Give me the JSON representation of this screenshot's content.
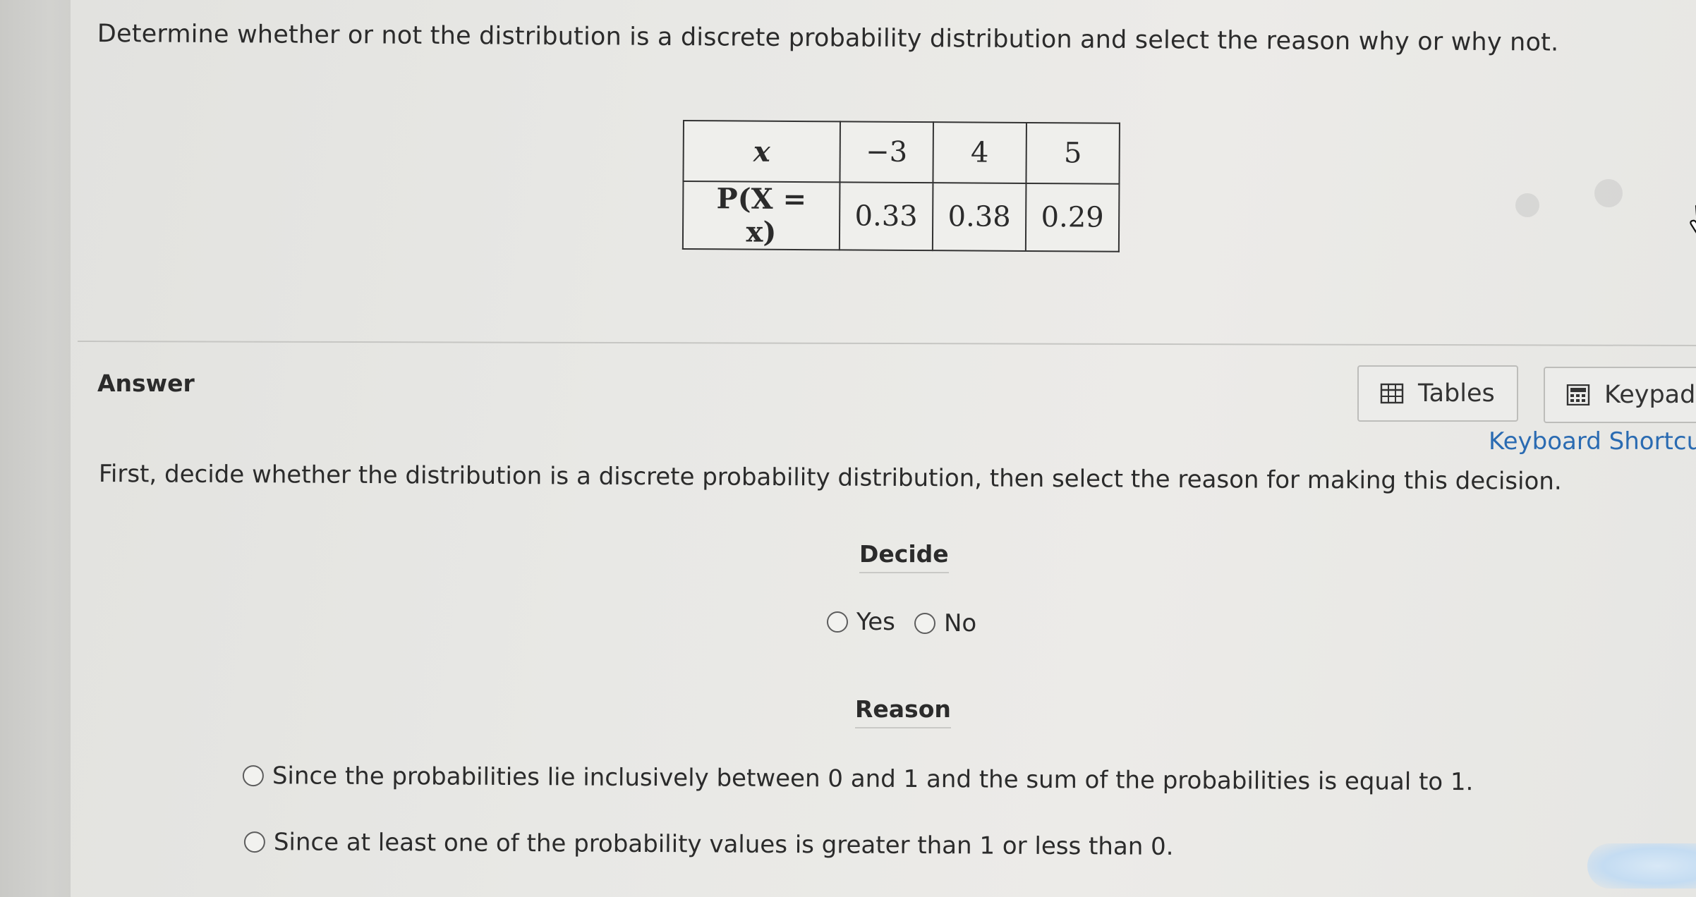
{
  "question": "Determine whether or not the distribution is a discrete probability distribution and select the reason why or why not.",
  "table": {
    "row_headers": [
      "x",
      "P(X = x)"
    ],
    "x_values": [
      "−3",
      "4",
      "5"
    ],
    "p_values": [
      "0.33",
      "0.38",
      "0.29"
    ]
  },
  "answer_label": "Answer",
  "toolbar": {
    "tables_label": "Tables",
    "keypad_label": "Keypad",
    "shortcuts_label": "Keyboard Shortcu"
  },
  "instruction": "First, decide whether the distribution is a discrete probability distribution, then select the reason for making this decision.",
  "decide": {
    "heading": "Decide",
    "options": [
      "Yes",
      "No"
    ]
  },
  "reason": {
    "heading": "Reason",
    "options": [
      "Since the probabilities lie inclusively between 0 and 1 and the sum of the probabilities is equal to 1.",
      "Since at least one of the probability values is greater than 1 or less than 0."
    ]
  },
  "icons": [
    "table-grid-icon",
    "calculator-icon",
    "hand-pointer-icon",
    "radio-circle-icon"
  ],
  "colors": {
    "link": "#2a6bb2",
    "background": "#e8e8e5",
    "text": "#2b2b2b"
  }
}
